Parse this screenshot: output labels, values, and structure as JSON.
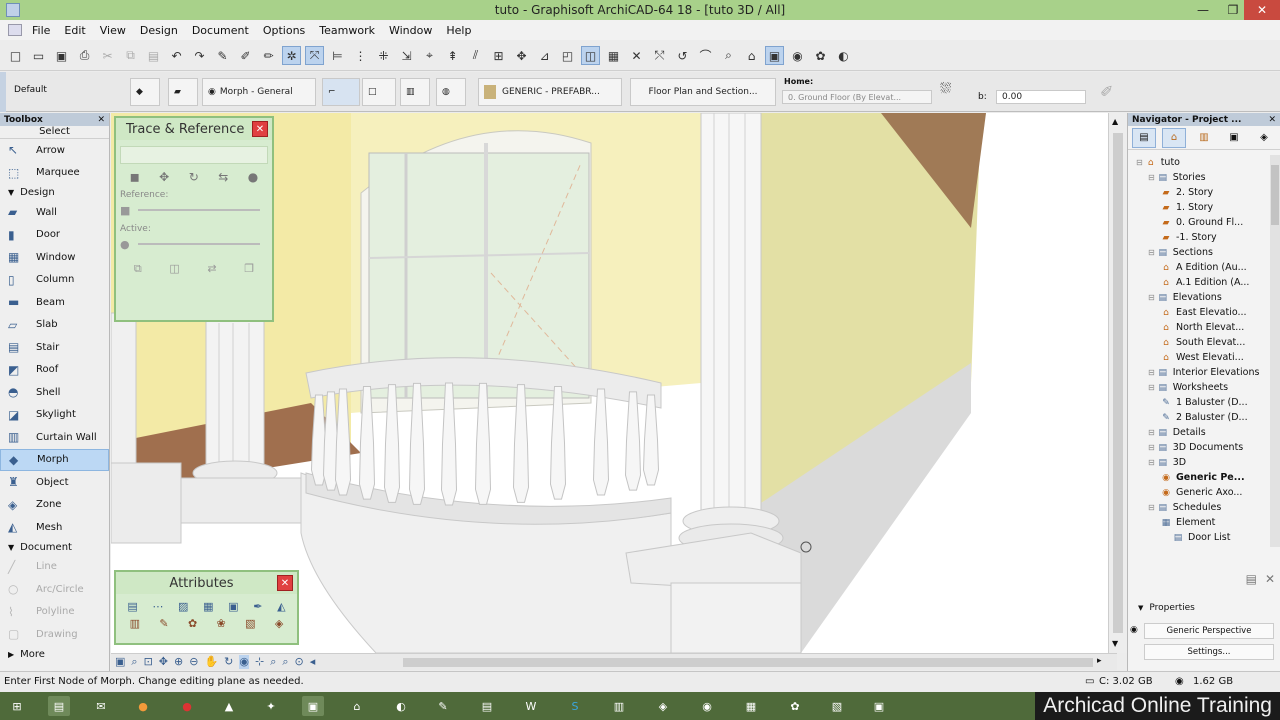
{
  "window": {
    "title": "tuto - Graphisoft ArchiCAD-64 18 - [tuto 3D / All]",
    "min_glyph": "—",
    "restore_glyph": "❐",
    "close_glyph": "✕"
  },
  "menu": [
    "File",
    "Edit",
    "View",
    "Design",
    "Document",
    "Options",
    "Teamwork",
    "Window",
    "Help"
  ],
  "infobox": {
    "layer": "Default",
    "element_label": "Morph - General",
    "material": "GENERIC - PREFABR...",
    "floor_plan": "Floor Plan and Section...",
    "home_label": "Home:",
    "home_value": "0. Ground Floor (By Elevat...",
    "offset_label": "b:",
    "offset_value": "0.00"
  },
  "toolbox": {
    "title": "Toolbox",
    "select_label": "Select",
    "pointer_items": [
      {
        "label": "Arrow",
        "icon": "↖"
      },
      {
        "label": "Marquee",
        "icon": "⬚"
      }
    ],
    "design_section": "Design",
    "design_items": [
      {
        "label": "Wall",
        "icon": "▰"
      },
      {
        "label": "Door",
        "icon": "▮"
      },
      {
        "label": "Window",
        "icon": "▦"
      },
      {
        "label": "Column",
        "icon": "▯"
      },
      {
        "label": "Beam",
        "icon": "▬"
      },
      {
        "label": "Slab",
        "icon": "▱"
      },
      {
        "label": "Stair",
        "icon": "▤"
      },
      {
        "label": "Roof",
        "icon": "◩"
      },
      {
        "label": "Shell",
        "icon": "◓"
      },
      {
        "label": "Skylight",
        "icon": "◪"
      },
      {
        "label": "Curtain Wall",
        "icon": "▥"
      },
      {
        "label": "Morph",
        "icon": "◆"
      },
      {
        "label": "Object",
        "icon": "♜"
      },
      {
        "label": "Zone",
        "icon": "◈"
      },
      {
        "label": "Mesh",
        "icon": "◭"
      }
    ],
    "document_section": "Document",
    "document_items": [
      {
        "label": "Line",
        "icon": "╱"
      },
      {
        "label": "Arc/Circle",
        "icon": "○"
      },
      {
        "label": "Polyline",
        "icon": "⌇"
      },
      {
        "label": "Drawing",
        "icon": "▢"
      }
    ],
    "more": "More"
  },
  "trace_panel": {
    "title": "Trace & Reference",
    "reference_label": "Reference:",
    "active_label": "Active:"
  },
  "attributes_panel": {
    "title": "Attributes"
  },
  "navigator": {
    "title": "Navigator - Project ...",
    "tree": [
      {
        "label": "tuto",
        "level": 0,
        "icon": "⌂"
      },
      {
        "label": "Stories",
        "level": 1,
        "icon": "▤"
      },
      {
        "label": "2. Story",
        "level": 2,
        "icon": "▰"
      },
      {
        "label": "1. Story",
        "level": 2,
        "icon": "▰"
      },
      {
        "label": "0. Ground Fl...",
        "level": 2,
        "icon": "▰"
      },
      {
        "label": "-1. Story",
        "level": 2,
        "icon": "▰"
      },
      {
        "label": "Sections",
        "level": 1,
        "icon": "▤"
      },
      {
        "label": "A Edition (Au...",
        "level": 2,
        "icon": "⌂"
      },
      {
        "label": "A.1 Edition (A...",
        "level": 2,
        "icon": "⌂"
      },
      {
        "label": "Elevations",
        "level": 1,
        "icon": "▤"
      },
      {
        "label": "East Elevatio...",
        "level": 2,
        "icon": "⌂"
      },
      {
        "label": "North Elevat...",
        "level": 2,
        "icon": "⌂"
      },
      {
        "label": "South Elevat...",
        "level": 2,
        "icon": "⌂"
      },
      {
        "label": "West Elevati...",
        "level": 2,
        "icon": "⌂"
      },
      {
        "label": "Interior Elevations",
        "level": 1,
        "icon": "▤"
      },
      {
        "label": "Worksheets",
        "level": 1,
        "icon": "▤"
      },
      {
        "label": "1 Baluster (D...",
        "level": 2,
        "icon": "✎"
      },
      {
        "label": "2 Baluster (D...",
        "level": 2,
        "icon": "✎"
      },
      {
        "label": "Details",
        "level": 1,
        "icon": "▤"
      },
      {
        "label": "3D Documents",
        "level": 1,
        "icon": "▤"
      },
      {
        "label": "3D",
        "level": 1,
        "icon": "▤"
      },
      {
        "label": "Generic Pe...",
        "level": 2,
        "icon": "◉",
        "bold": true
      },
      {
        "label": "Generic Axo...",
        "level": 2,
        "icon": "◉"
      },
      {
        "label": "Schedules",
        "level": 1,
        "icon": "▤"
      },
      {
        "label": "Element",
        "level": 2,
        "icon": "▦"
      },
      {
        "label": "Door List",
        "level": 3,
        "icon": "▤"
      }
    ],
    "properties_label": "Properties",
    "perspective_value": "Generic Perspective",
    "settings_label": "Settings..."
  },
  "status": {
    "prompt": "Enter First Node of Morph. Change editing plane as needed.",
    "disk": "C: 3.02 GB",
    "memory": "1.62 GB"
  },
  "watermark": "Archicad Online Training"
}
